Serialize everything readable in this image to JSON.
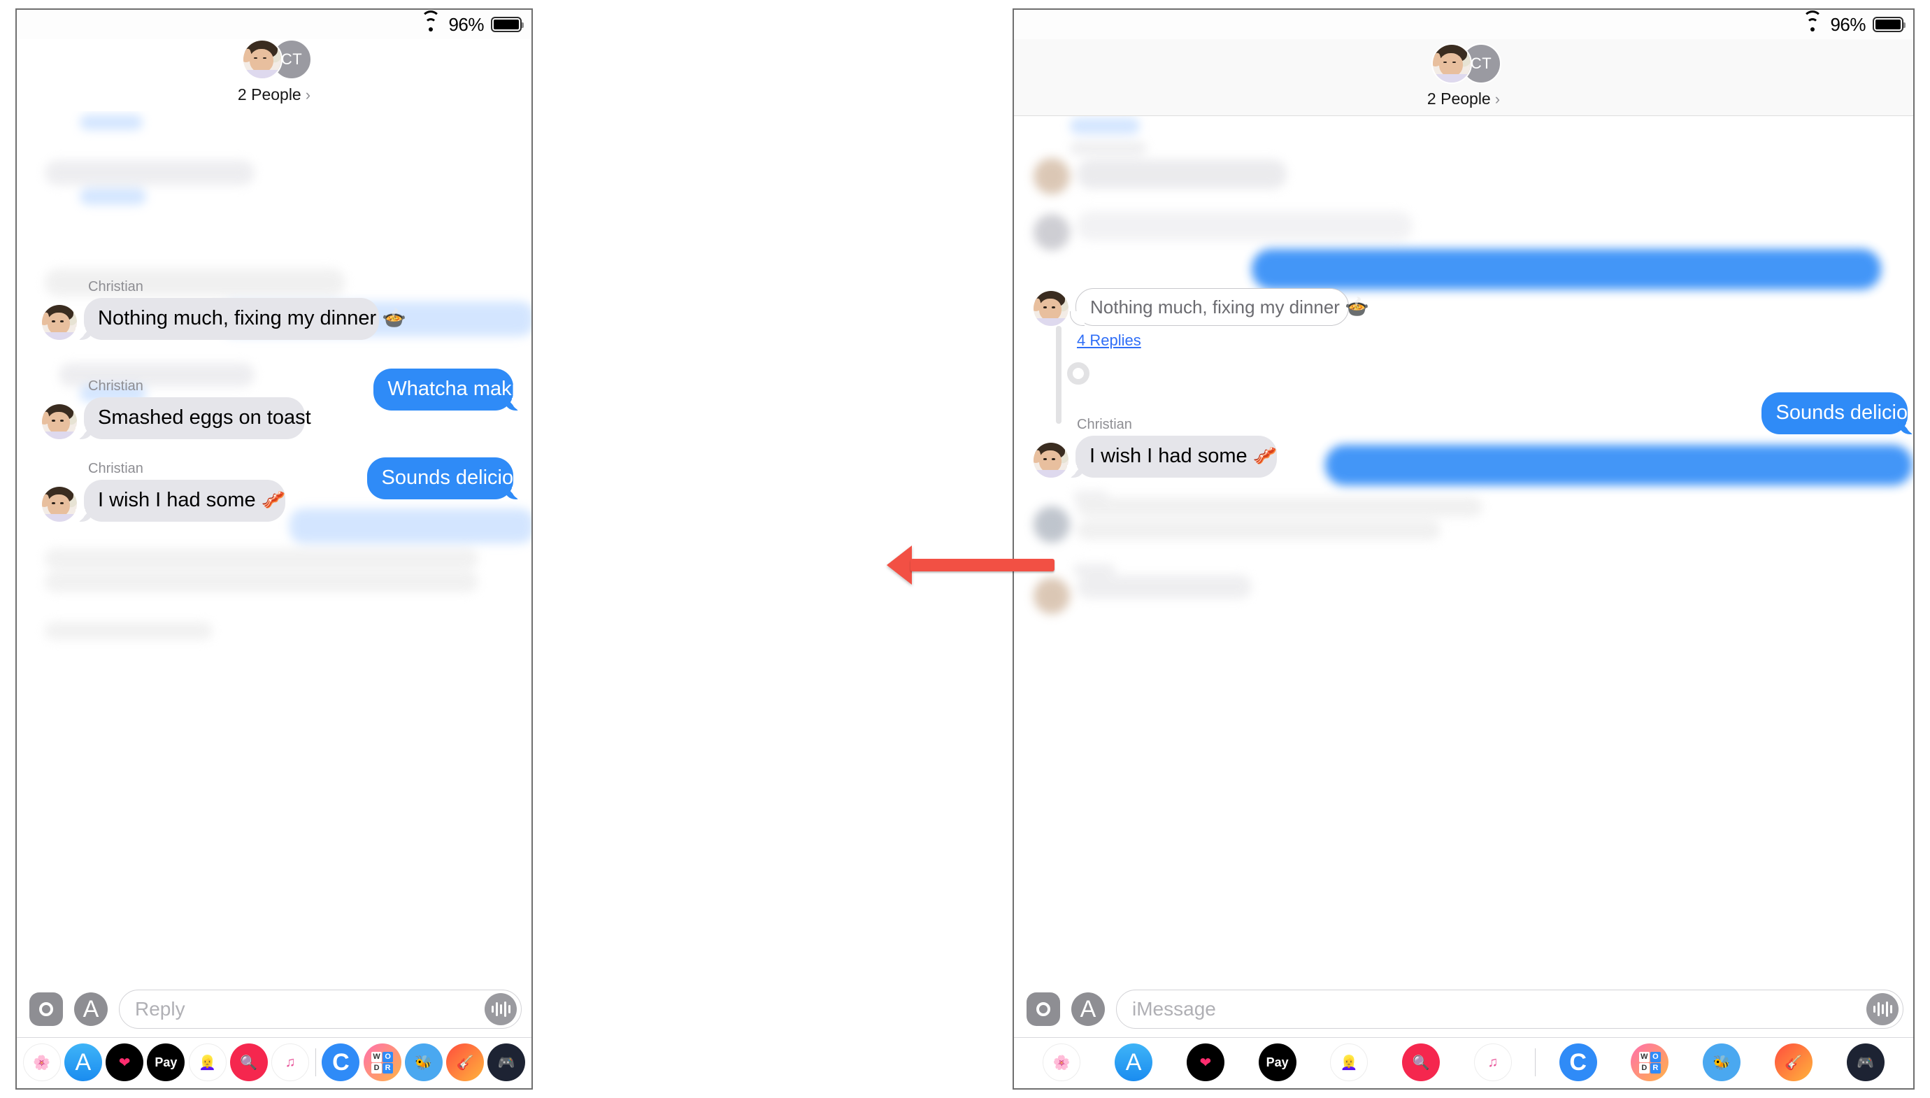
{
  "status_bar": {
    "wifi": "wifi-icon",
    "battery_percent": "96%",
    "battery": "battery-full-icon"
  },
  "conversation": {
    "participants_label": "2 People",
    "chevron": "›",
    "avatar_initials": "CT",
    "sender_name": "Christian"
  },
  "left_panel": {
    "input": {
      "placeholder": "Reply",
      "value": ""
    },
    "messages": [
      {
        "id": "m1",
        "side": "incoming",
        "sender": "Christian",
        "text": "Nothing much, fixing my dinner",
        "emoji": "🍲",
        "redacted": false
      },
      {
        "id": "m2",
        "side": "outgoing",
        "text": "Whatcha makin?",
        "redacted": false
      },
      {
        "id": "m3",
        "side": "incoming",
        "sender": "Christian",
        "text": "Smashed eggs on toast",
        "redacted": false
      },
      {
        "id": "m4",
        "side": "outgoing",
        "text": "Sounds delicious!",
        "redacted": false
      },
      {
        "id": "m5",
        "side": "incoming",
        "sender": "Christian",
        "text": "I wish I had some",
        "emoji": "🥓",
        "redacted": false
      }
    ]
  },
  "right_panel": {
    "input": {
      "placeholder": "iMessage",
      "value": ""
    },
    "thread": {
      "origin_text": "Nothing much, fixing my dinner",
      "origin_emoji": "🍲",
      "replies_label": "4 Replies"
    },
    "messages": [
      {
        "id": "r1",
        "side": "outgoing",
        "text": "Sounds delicious!",
        "redacted": false
      },
      {
        "id": "r2",
        "side": "incoming",
        "sender": "Christian",
        "text": "I wish I had some",
        "emoji": "🥓",
        "redacted": false
      }
    ]
  },
  "annotation": {
    "arrow": "red-left-arrow",
    "color": "#f25044",
    "direction": "left"
  },
  "app_drawer": {
    "apps": [
      {
        "name": "photos-app-icon",
        "glyph": "✿"
      },
      {
        "name": "app-store-app-icon",
        "glyph": "A"
      },
      {
        "name": "music-heart-app-icon",
        "glyph": "♥"
      },
      {
        "name": "apple-pay-app-icon",
        "glyph": "Pay"
      },
      {
        "name": "memoji-app-icon",
        "glyph": "👩"
      },
      {
        "name": "images-app-icon",
        "glyph": "🔎"
      },
      {
        "name": "apple-music-app-icon",
        "glyph": "♫"
      },
      {
        "name": "cameo-app-icon",
        "glyph": "C"
      },
      {
        "name": "words-app-icon",
        "glyph": "WODR"
      },
      {
        "name": "bee-game-app-icon",
        "glyph": "🐝"
      },
      {
        "name": "guitar-app-icon",
        "glyph": "🎸"
      },
      {
        "name": "game-pigeon-app-icon",
        "glyph": "🎮"
      }
    ]
  },
  "colors": {
    "outgoing_bubble": "#2f8bf7",
    "incoming_bubble": "#e5e5ea",
    "link": "#2f6ef7",
    "arrow": "#f25044"
  }
}
